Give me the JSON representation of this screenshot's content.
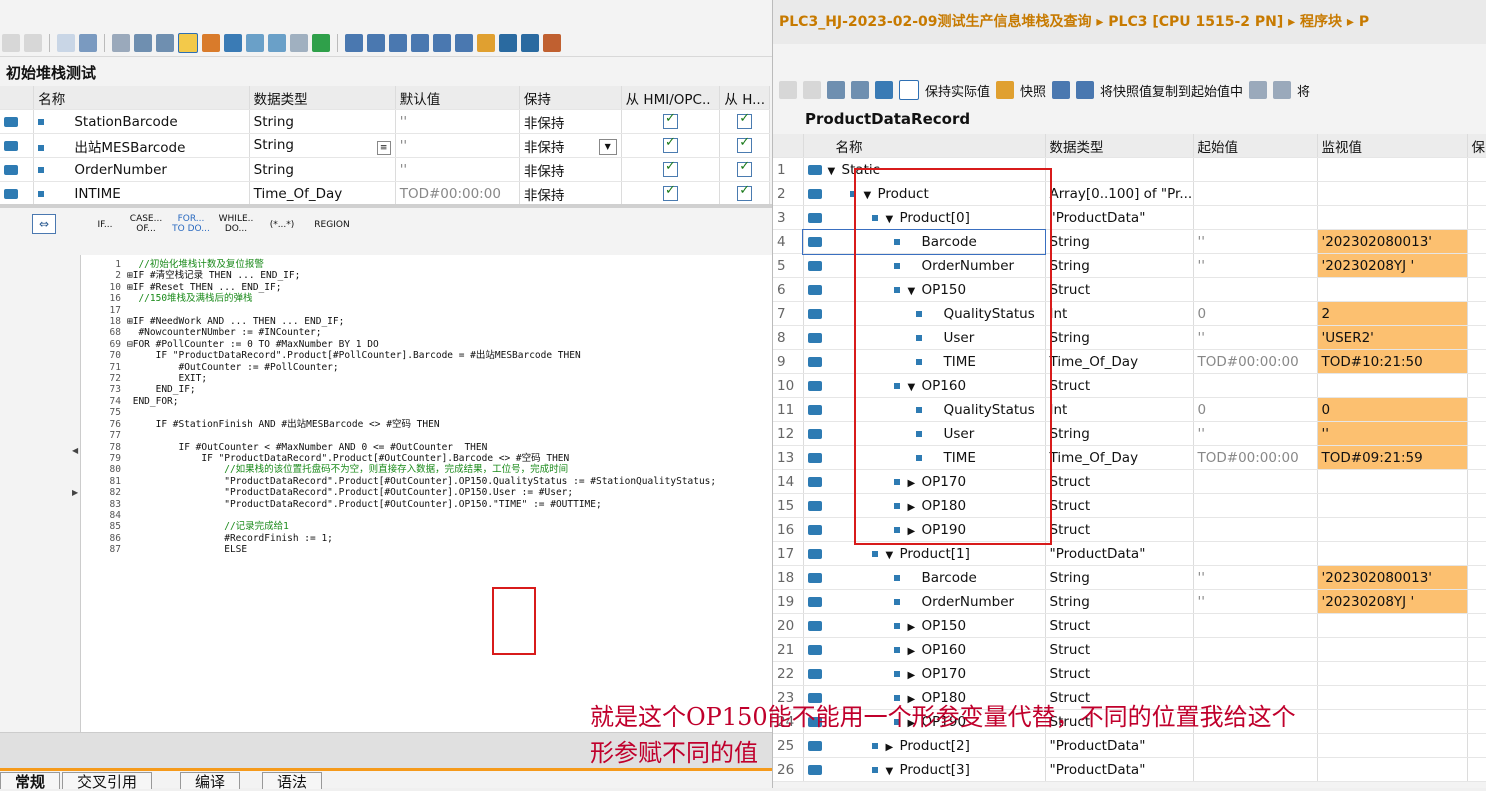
{
  "left": {
    "block_title": "初始堆栈测试",
    "columns": [
      "名称",
      "数据类型",
      "默认值",
      "保持",
      "从 HMI/OPC..",
      "从 H..."
    ],
    "rows": [
      {
        "name": "StationBarcode",
        "type": "String",
        "default": "''",
        "retain": "非保持"
      },
      {
        "name": "出站MESBarcode",
        "type": "String",
        "default": "''",
        "retain": "非保持"
      },
      {
        "name": "OrderNumber",
        "type": "String",
        "default": "''",
        "retain": "非保持"
      },
      {
        "name": "INTIME",
        "type": "Time_Of_Day",
        "default": "TOD#00:00:00",
        "retain": "非保持"
      }
    ],
    "struct_buttons": [
      "IF...",
      "CASE... OF...",
      "FOR... TO DO...",
      "WHILE.. DO...",
      "(*...*)",
      "REGION"
    ],
    "code_lines": [
      {
        "n": "1",
        "t": "  //初始化堆栈计数及复位报警"
      },
      {
        "n": "2",
        "t": "⊞IF #清空栈记录 THEN ... END_IF;"
      },
      {
        "n": "10",
        "t": "⊞IF #Reset THEN ... END_IF;"
      },
      {
        "n": "16",
        "t": "  //150堆栈及满栈后的弹栈"
      },
      {
        "n": "17",
        "t": ""
      },
      {
        "n": "18",
        "t": "⊞IF #NeedWork AND ... THEN ... END_IF;"
      },
      {
        "n": "68",
        "t": "  #NowcounterNUmber := #INCounter;"
      },
      {
        "n": "69",
        "t": "⊟FOR #PollCounter := 0 TO #MaxNumber BY 1 DO"
      },
      {
        "n": "70",
        "t": "     IF \"ProductDataRecord\".Product[#PollCounter].Barcode = #出站MESBarcode THEN"
      },
      {
        "n": "71",
        "t": "         #OutCounter := #PollCounter;"
      },
      {
        "n": "72",
        "t": "         EXIT;"
      },
      {
        "n": "73",
        "t": "     END_IF;"
      },
      {
        "n": "74",
        "t": " END_FOR;"
      },
      {
        "n": "75",
        "t": ""
      },
      {
        "n": "76",
        "t": "     IF #StationFinish AND #出站MESBarcode <> #空码 THEN"
      },
      {
        "n": "77",
        "t": ""
      },
      {
        "n": "78",
        "t": "         IF #OutCounter < #MaxNumber AND 0 <= #OutCounter  THEN"
      },
      {
        "n": "79",
        "t": "             IF \"ProductDataRecord\".Product[#OutCounter].Barcode <> #空码 THEN"
      },
      {
        "n": "80",
        "t": "                 //如果栈的该位置托盘码不为空，则直接存入数据，完成结果，工位号，完成时间"
      },
      {
        "n": "81",
        "t": "                 \"ProductDataRecord\".Product[#OutCounter].OP150.QualityStatus := #StationQualityStatus;"
      },
      {
        "n": "82",
        "t": "                 \"ProductDataRecord\".Product[#OutCounter].OP150.User := #User;"
      },
      {
        "n": "83",
        "t": "                 \"ProductDataRecord\".Product[#OutCounter].OP150.\"TIME\" := #OUTTIME;"
      },
      {
        "n": "84",
        "t": ""
      },
      {
        "n": "85",
        "t": "                 //记录完成给1"
      },
      {
        "n": "86",
        "t": "                 #RecordFinish := 1;"
      },
      {
        "n": "87",
        "t": "                 ELSE"
      }
    ],
    "bottom_tabs": [
      "常规",
      "交叉引用",
      "编译",
      "语法"
    ]
  },
  "right": {
    "breadcrumb": "PLC3_HJ-2023-02-09测试生产信息堆栈及查询 ▸ PLC3 [CPU 1515-2 PN] ▸ 程序块 ▸ P",
    "toolbar": {
      "keep_actual": "保持实际值",
      "snapshot": "快照",
      "copy_snapshot": "将快照值复制到起始值中",
      "extra": "将"
    },
    "db_title": "ProductDataRecord",
    "columns": [
      "名称",
      "数据类型",
      "起始值",
      "监视值",
      "保"
    ],
    "rows": [
      {
        "n": "1",
        "indent": 0,
        "arrow": "▼",
        "name": "Static",
        "type": "",
        "start": "",
        "mon": ""
      },
      {
        "n": "2",
        "indent": 1,
        "arrow": "▼",
        "name": "Product",
        "type": "Array[0..100] of \"Pr...",
        "start": "",
        "mon": ""
      },
      {
        "n": "3",
        "indent": 2,
        "arrow": "▼",
        "name": "Product[0]",
        "type": "\"ProductData\"",
        "start": "",
        "mon": ""
      },
      {
        "n": "4",
        "indent": 3,
        "arrow": "",
        "name": "Barcode",
        "type": "String",
        "start": "''",
        "mon": "'202302080013'"
      },
      {
        "n": "5",
        "indent": 3,
        "arrow": "",
        "name": "OrderNumber",
        "type": "String",
        "start": "''",
        "mon": "'20230208YJ '"
      },
      {
        "n": "6",
        "indent": 3,
        "arrow": "▼",
        "name": "OP150",
        "type": "Struct",
        "start": "",
        "mon": ""
      },
      {
        "n": "7",
        "indent": 4,
        "arrow": "",
        "name": "QualityStatus",
        "type": "Int",
        "start": "0",
        "mon": "2"
      },
      {
        "n": "8",
        "indent": 4,
        "arrow": "",
        "name": "User",
        "type": "String",
        "start": "''",
        "mon": "'USER2'"
      },
      {
        "n": "9",
        "indent": 4,
        "arrow": "",
        "name": "TIME",
        "type": "Time_Of_Day",
        "start": "TOD#00:00:00",
        "mon": "TOD#10:21:50"
      },
      {
        "n": "10",
        "indent": 3,
        "arrow": "▼",
        "name": "OP160",
        "type": "Struct",
        "start": "",
        "mon": ""
      },
      {
        "n": "11",
        "indent": 4,
        "arrow": "",
        "name": "QualityStatus",
        "type": "Int",
        "start": "0",
        "mon": "0"
      },
      {
        "n": "12",
        "indent": 4,
        "arrow": "",
        "name": "User",
        "type": "String",
        "start": "''",
        "mon": "''"
      },
      {
        "n": "13",
        "indent": 4,
        "arrow": "",
        "name": "TIME",
        "type": "Time_Of_Day",
        "start": "TOD#00:00:00",
        "mon": "TOD#09:21:59"
      },
      {
        "n": "14",
        "indent": 3,
        "arrow": "▶",
        "name": "OP170",
        "type": "Struct",
        "start": "",
        "mon": ""
      },
      {
        "n": "15",
        "indent": 3,
        "arrow": "▶",
        "name": "OP180",
        "type": "Struct",
        "start": "",
        "mon": ""
      },
      {
        "n": "16",
        "indent": 3,
        "arrow": "▶",
        "name": "OP190",
        "type": "Struct",
        "start": "",
        "mon": ""
      },
      {
        "n": "17",
        "indent": 2,
        "arrow": "▼",
        "name": "Product[1]",
        "type": "\"ProductData\"",
        "start": "",
        "mon": ""
      },
      {
        "n": "18",
        "indent": 3,
        "arrow": "",
        "name": "Barcode",
        "type": "String",
        "start": "''",
        "mon": "'202302080013'"
      },
      {
        "n": "19",
        "indent": 3,
        "arrow": "",
        "name": "OrderNumber",
        "type": "String",
        "start": "''",
        "mon": "'20230208YJ '"
      },
      {
        "n": "20",
        "indent": 3,
        "arrow": "▶",
        "name": "OP150",
        "type": "Struct",
        "start": "",
        "mon": ""
      },
      {
        "n": "21",
        "indent": 3,
        "arrow": "▶",
        "name": "OP160",
        "type": "Struct",
        "start": "",
        "mon": ""
      },
      {
        "n": "22",
        "indent": 3,
        "arrow": "▶",
        "name": "OP170",
        "type": "Struct",
        "start": "",
        "mon": ""
      },
      {
        "n": "23",
        "indent": 3,
        "arrow": "▶",
        "name": "OP180",
        "type": "Struct",
        "start": "",
        "mon": ""
      },
      {
        "n": "24",
        "indent": 3,
        "arrow": "▶",
        "name": "OP190",
        "type": "Struct",
        "start": "",
        "mon": ""
      },
      {
        "n": "25",
        "indent": 2,
        "arrow": "▶",
        "name": "Product[2]",
        "type": "\"ProductData\"",
        "start": "",
        "mon": ""
      },
      {
        "n": "26",
        "indent": 2,
        "arrow": "▼",
        "name": "Product[3]",
        "type": "\"ProductData\"",
        "start": "",
        "mon": ""
      }
    ]
  },
  "annotation": {
    "line1": "就是这个OP150能不能用一个形参变量代替，不同的位置我给这个",
    "line2": "形参赋不同的值"
  },
  "colors": {
    "breadcrumb": "#c77a00",
    "monitor_bg": "#fcc070",
    "annotation": "#c0002c",
    "highlight_box": "#d81b1b"
  }
}
